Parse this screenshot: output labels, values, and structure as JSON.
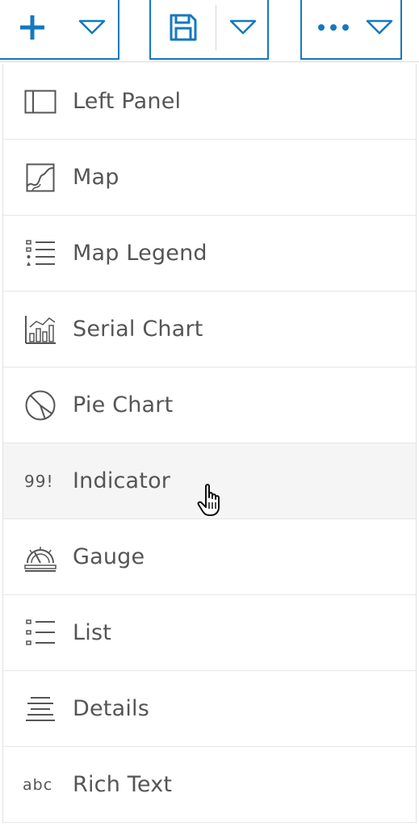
{
  "colors": {
    "accent": "#1479bf",
    "text": "#555555",
    "icon": "#555555",
    "hover_bg": "#f5f5f5"
  },
  "toolbar": {
    "add": {
      "icon": "plus-icon",
      "dropdown_icon": "triangle-down-icon"
    },
    "save": {
      "icon": "save-icon",
      "dropdown_icon": "triangle-down-icon"
    },
    "more": {
      "icon": "ellipsis-icon",
      "dropdown_icon": "triangle-down-icon"
    }
  },
  "menu": {
    "items": [
      {
        "label": "Left Panel",
        "icon": "left-panel-icon"
      },
      {
        "label": "Map",
        "icon": "map-icon"
      },
      {
        "label": "Map Legend",
        "icon": "map-legend-icon"
      },
      {
        "label": "Serial Chart",
        "icon": "serial-chart-icon"
      },
      {
        "label": "Pie Chart",
        "icon": "pie-chart-icon"
      },
      {
        "label": "Indicator",
        "icon": "indicator-icon",
        "icon_text": "99!",
        "hovered": true
      },
      {
        "label": "Gauge",
        "icon": "gauge-icon"
      },
      {
        "label": "List",
        "icon": "list-icon"
      },
      {
        "label": "Details",
        "icon": "details-icon"
      },
      {
        "label": "Rich Text",
        "icon": "rich-text-icon",
        "icon_text": "abc"
      }
    ]
  },
  "cursor": "hand-pointer-cursor"
}
